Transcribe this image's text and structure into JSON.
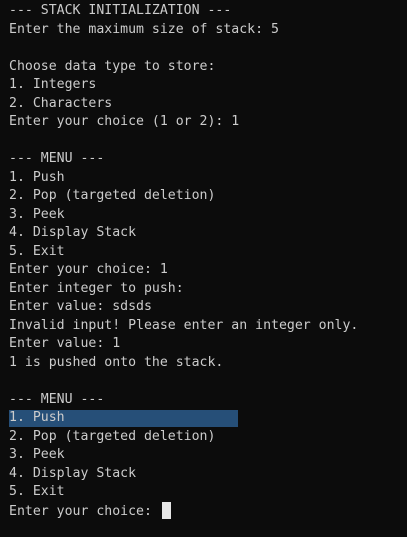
{
  "colors": {
    "background": "#0c0c0c",
    "text": "#cccccc",
    "selection": "#264f78",
    "cursor": "#e6e6e6"
  },
  "lines": [
    "--- STACK INITIALIZATION ---",
    "Enter the maximum size of stack: 5",
    "",
    "Choose data type to store:",
    "1. Integers",
    "2. Characters",
    "Enter your choice (1 or 2): 1",
    "",
    "--- MENU ---",
    "1. Push",
    "2. Pop (targeted deletion)",
    "3. Peek",
    "4. Display Stack",
    "5. Exit",
    "Enter your choice: 1",
    "Enter integer to push:",
    "Enter value: sdsds",
    "Invalid input! Please enter an integer only.",
    "Enter value: 1",
    "1 is pushed onto the stack.",
    "",
    "--- MENU ---",
    "1. Push",
    "2. Pop (targeted deletion)",
    "3. Peek",
    "4. Display Stack",
    "5. Exit"
  ],
  "prompt": "Enter your choice: "
}
